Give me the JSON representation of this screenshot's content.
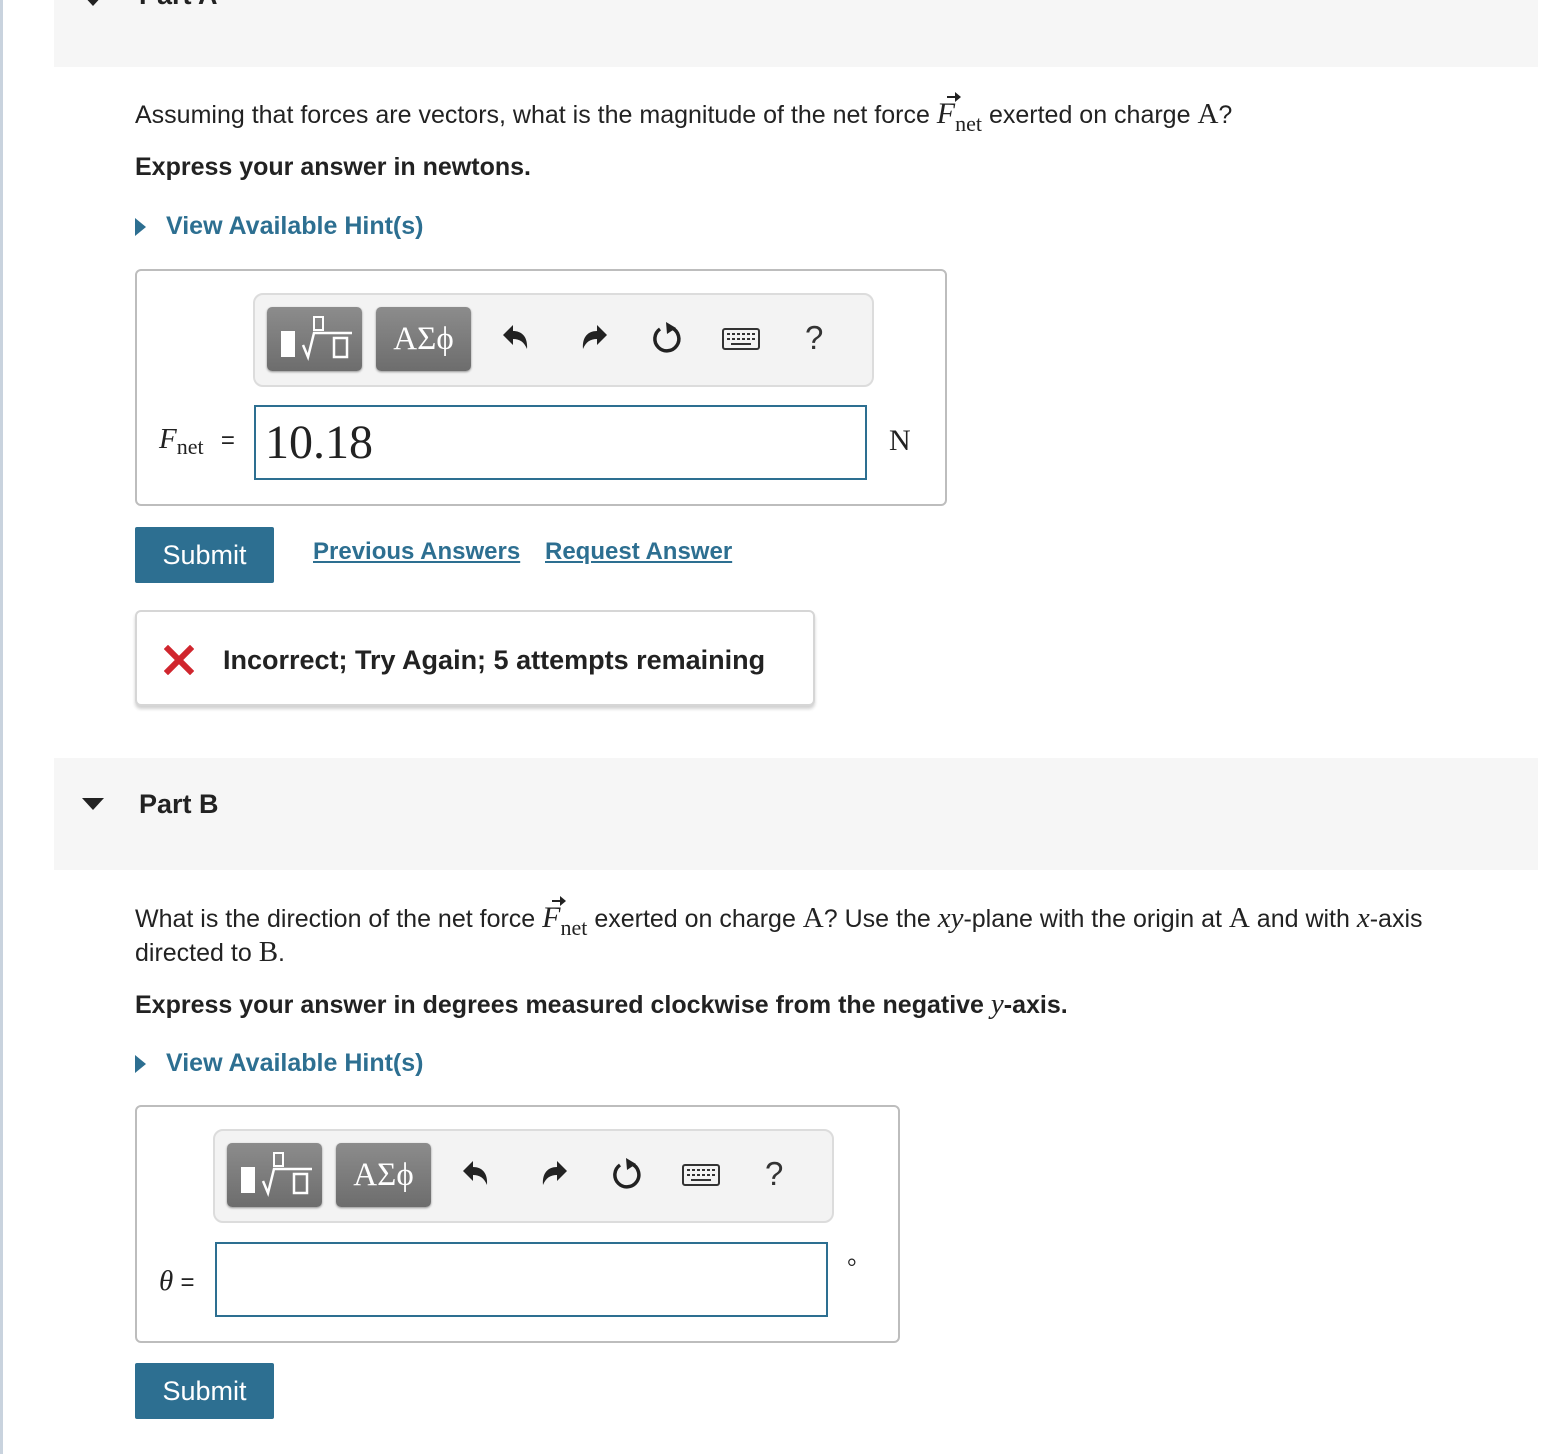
{
  "part_a": {
    "title": "Part A",
    "question_pre": "Assuming that forces are vectors, what is the magnitude of the net force ",
    "force_symbol": "F",
    "force_sub": "net",
    "question_mid": " exerted on charge ",
    "charge": "A",
    "question_end": "?",
    "instruction": "Express your answer in newtons.",
    "hint_label": "View Available Hint(s)",
    "greek_button": "ΑΣϕ",
    "help": "?",
    "answer_symbol": "F",
    "answer_sub": "net",
    "equals": "=",
    "answer_value": "10.18",
    "unit": "N",
    "submit": "Submit",
    "previous_answers": "Previous Answers",
    "request_answer": "Request Answer",
    "feedback": "Incorrect; Try Again; 5 attempts remaining"
  },
  "part_b": {
    "title": "Part B",
    "q1": "What is the direction of the net force ",
    "force_symbol": "F",
    "force_sub": "net",
    "q2": " exerted on charge ",
    "charge_a": "A",
    "q3": "? Use the ",
    "plane": "xy",
    "q4": "-plane with the origin at ",
    "origin": "A",
    "q5": " and with ",
    "axis": "x",
    "q6": "-axis",
    "q7": "directed to ",
    "charge_b": "B",
    "q8": ".",
    "instruction_pre": "Express your answer in degrees measured clockwise from the negative ",
    "instruction_axis": "y",
    "instruction_post": "-axis.",
    "hint_label": "View Available Hint(s)",
    "greek_button": "ΑΣϕ",
    "help": "?",
    "answer_symbol": "θ",
    "equals": "=",
    "answer_value": "",
    "unit": "°",
    "submit": "Submit"
  },
  "colors": {
    "accent": "#2d6f91",
    "error": "#d0262e",
    "header_bg": "#f6f6f6"
  }
}
